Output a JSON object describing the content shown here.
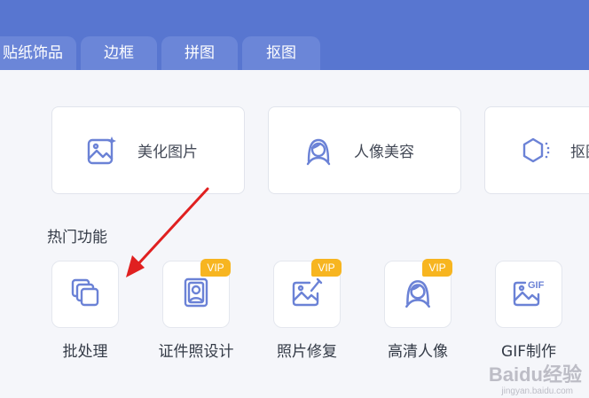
{
  "tabs": [
    {
      "label": "贴纸饰品"
    },
    {
      "label": "边框"
    },
    {
      "label": "拼图"
    },
    {
      "label": "抠图"
    }
  ],
  "cards": [
    {
      "label": "美化图片",
      "icon": "image-sparkle-icon"
    },
    {
      "label": "人像美容",
      "icon": "portrait-icon"
    },
    {
      "label": "抠图",
      "icon": "hexagon-cutout-icon"
    }
  ],
  "section": {
    "title": "热门功能"
  },
  "features": [
    {
      "label": "批处理",
      "icon": "batch-layers-icon",
      "vip": ""
    },
    {
      "label": "证件照设计",
      "icon": "id-photo-icon",
      "vip": "VIP"
    },
    {
      "label": "照片修复",
      "icon": "photo-repair-icon",
      "vip": "VIP"
    },
    {
      "label": "高清人像",
      "icon": "hd-portrait-icon",
      "vip": "VIP"
    },
    {
      "label": "GIF制作",
      "icon": "gif-icon",
      "vip": ""
    }
  ],
  "gif_badge": "GIF",
  "watermark": {
    "text": "Baidu经验",
    "sub": "jingyan.baidu.com"
  },
  "colors": {
    "topbar": "#5876d0",
    "tab": "#6b86d8",
    "icon": "#6b82d6",
    "vip": "#f7b520",
    "arrow": "#e02020"
  }
}
